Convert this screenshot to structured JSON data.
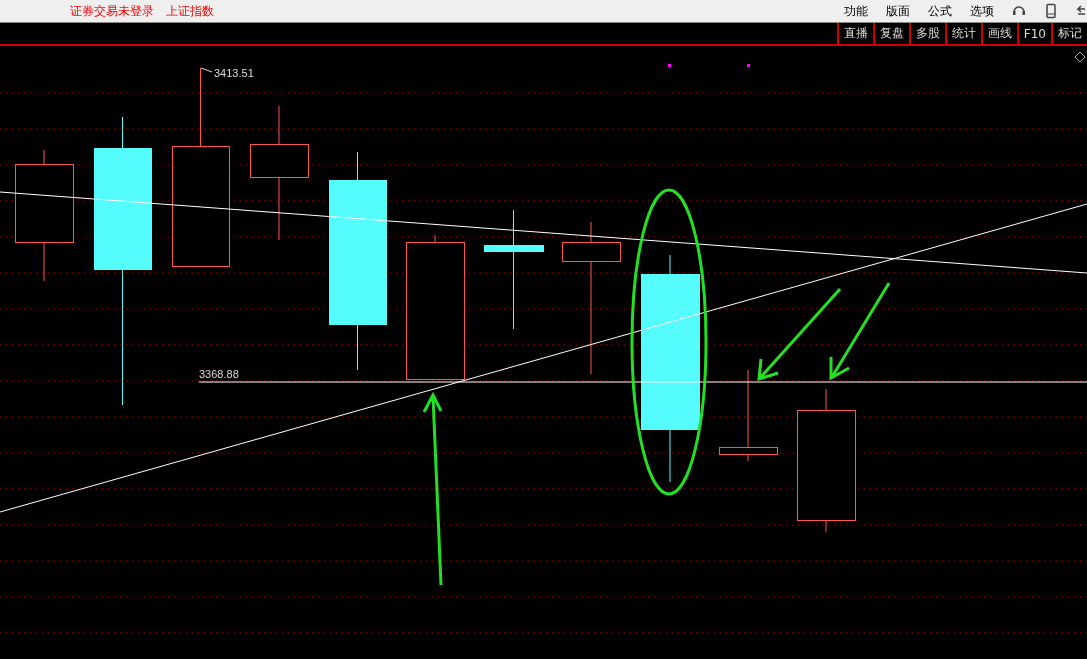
{
  "top_bar": {
    "login_status": "证券交易未登录",
    "index_name": "上证指数",
    "menu": [
      "功能",
      "版面",
      "公式",
      "选项"
    ]
  },
  "toolbar": [
    "直播",
    "复盘",
    "多股",
    "统计",
    "画线",
    "F10",
    "标记"
  ],
  "chart": {
    "high_label": "3413.51",
    "level_label": "3368.88"
  }
}
